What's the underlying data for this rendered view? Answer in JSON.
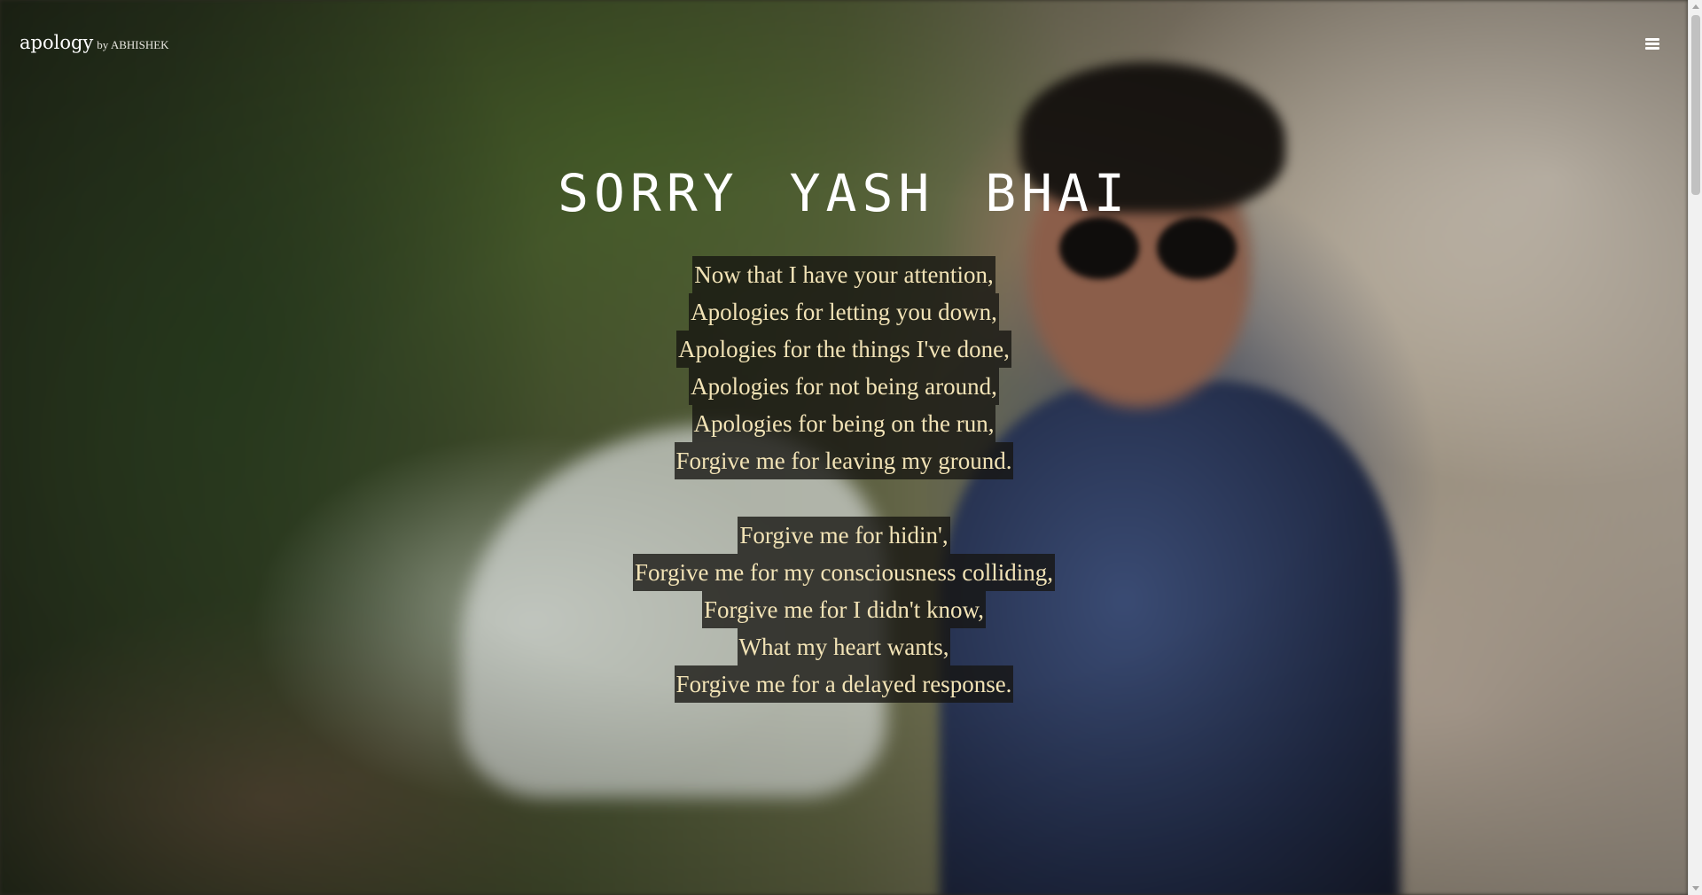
{
  "header": {
    "brand_name": "apology",
    "brand_byline": "by ABHISHEK",
    "menu_icon": "hamburger-menu-icon"
  },
  "main": {
    "title": "SORRY YASH BHAI",
    "stanzas": [
      {
        "lines": [
          "Now that I have your attention,",
          "Apologies for letting you down,",
          "Apologies for the things I've done,",
          "Apologies for not being around,",
          "Apologies for being on the run,",
          "Forgive me for leaving my ground."
        ]
      },
      {
        "lines": [
          "Forgive me for hidin',",
          "Forgive me for my consciousness colliding,",
          "Forgive me for I didn't know,",
          "What my heart wants,",
          "Forgive me for a delayed response."
        ]
      }
    ]
  },
  "colors": {
    "poem_text": "#f2e3b6",
    "poem_highlight": "#161411",
    "title_text": "#ffffff"
  }
}
